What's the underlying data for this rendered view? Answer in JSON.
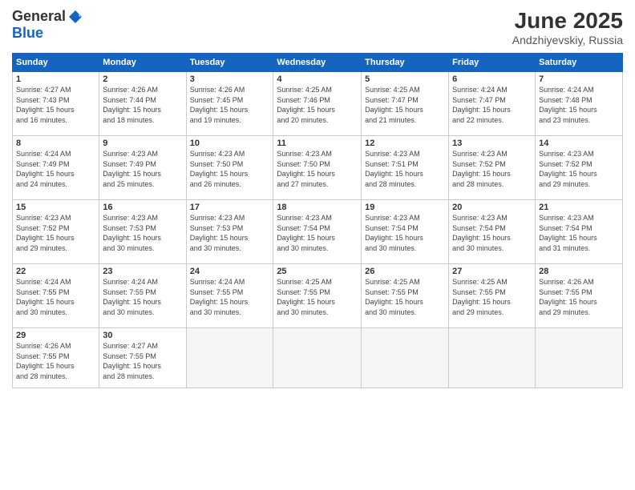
{
  "logo": {
    "general": "General",
    "blue": "Blue"
  },
  "title": "June 2025",
  "location": "Andzhiyevskiy, Russia",
  "days_of_week": [
    "Sunday",
    "Monday",
    "Tuesday",
    "Wednesday",
    "Thursday",
    "Friday",
    "Saturday"
  ],
  "weeks": [
    [
      {
        "day": "1",
        "info": "Sunrise: 4:27 AM\nSunset: 7:43 PM\nDaylight: 15 hours\nand 16 minutes."
      },
      {
        "day": "2",
        "info": "Sunrise: 4:26 AM\nSunset: 7:44 PM\nDaylight: 15 hours\nand 18 minutes."
      },
      {
        "day": "3",
        "info": "Sunrise: 4:26 AM\nSunset: 7:45 PM\nDaylight: 15 hours\nand 19 minutes."
      },
      {
        "day": "4",
        "info": "Sunrise: 4:25 AM\nSunset: 7:46 PM\nDaylight: 15 hours\nand 20 minutes."
      },
      {
        "day": "5",
        "info": "Sunrise: 4:25 AM\nSunset: 7:47 PM\nDaylight: 15 hours\nand 21 minutes."
      },
      {
        "day": "6",
        "info": "Sunrise: 4:24 AM\nSunset: 7:47 PM\nDaylight: 15 hours\nand 22 minutes."
      },
      {
        "day": "7",
        "info": "Sunrise: 4:24 AM\nSunset: 7:48 PM\nDaylight: 15 hours\nand 23 minutes."
      }
    ],
    [
      {
        "day": "8",
        "info": "Sunrise: 4:24 AM\nSunset: 7:49 PM\nDaylight: 15 hours\nand 24 minutes."
      },
      {
        "day": "9",
        "info": "Sunrise: 4:23 AM\nSunset: 7:49 PM\nDaylight: 15 hours\nand 25 minutes."
      },
      {
        "day": "10",
        "info": "Sunrise: 4:23 AM\nSunset: 7:50 PM\nDaylight: 15 hours\nand 26 minutes."
      },
      {
        "day": "11",
        "info": "Sunrise: 4:23 AM\nSunset: 7:50 PM\nDaylight: 15 hours\nand 27 minutes."
      },
      {
        "day": "12",
        "info": "Sunrise: 4:23 AM\nSunset: 7:51 PM\nDaylight: 15 hours\nand 28 minutes."
      },
      {
        "day": "13",
        "info": "Sunrise: 4:23 AM\nSunset: 7:52 PM\nDaylight: 15 hours\nand 28 minutes."
      },
      {
        "day": "14",
        "info": "Sunrise: 4:23 AM\nSunset: 7:52 PM\nDaylight: 15 hours\nand 29 minutes."
      }
    ],
    [
      {
        "day": "15",
        "info": "Sunrise: 4:23 AM\nSunset: 7:52 PM\nDaylight: 15 hours\nand 29 minutes."
      },
      {
        "day": "16",
        "info": "Sunrise: 4:23 AM\nSunset: 7:53 PM\nDaylight: 15 hours\nand 30 minutes."
      },
      {
        "day": "17",
        "info": "Sunrise: 4:23 AM\nSunset: 7:53 PM\nDaylight: 15 hours\nand 30 minutes."
      },
      {
        "day": "18",
        "info": "Sunrise: 4:23 AM\nSunset: 7:54 PM\nDaylight: 15 hours\nand 30 minutes."
      },
      {
        "day": "19",
        "info": "Sunrise: 4:23 AM\nSunset: 7:54 PM\nDaylight: 15 hours\nand 30 minutes."
      },
      {
        "day": "20",
        "info": "Sunrise: 4:23 AM\nSunset: 7:54 PM\nDaylight: 15 hours\nand 30 minutes."
      },
      {
        "day": "21",
        "info": "Sunrise: 4:23 AM\nSunset: 7:54 PM\nDaylight: 15 hours\nand 31 minutes."
      }
    ],
    [
      {
        "day": "22",
        "info": "Sunrise: 4:24 AM\nSunset: 7:55 PM\nDaylight: 15 hours\nand 30 minutes."
      },
      {
        "day": "23",
        "info": "Sunrise: 4:24 AM\nSunset: 7:55 PM\nDaylight: 15 hours\nand 30 minutes."
      },
      {
        "day": "24",
        "info": "Sunrise: 4:24 AM\nSunset: 7:55 PM\nDaylight: 15 hours\nand 30 minutes."
      },
      {
        "day": "25",
        "info": "Sunrise: 4:25 AM\nSunset: 7:55 PM\nDaylight: 15 hours\nand 30 minutes."
      },
      {
        "day": "26",
        "info": "Sunrise: 4:25 AM\nSunset: 7:55 PM\nDaylight: 15 hours\nand 30 minutes."
      },
      {
        "day": "27",
        "info": "Sunrise: 4:25 AM\nSunset: 7:55 PM\nDaylight: 15 hours\nand 29 minutes."
      },
      {
        "day": "28",
        "info": "Sunrise: 4:26 AM\nSunset: 7:55 PM\nDaylight: 15 hours\nand 29 minutes."
      }
    ],
    [
      {
        "day": "29",
        "info": "Sunrise: 4:26 AM\nSunset: 7:55 PM\nDaylight: 15 hours\nand 28 minutes."
      },
      {
        "day": "30",
        "info": "Sunrise: 4:27 AM\nSunset: 7:55 PM\nDaylight: 15 hours\nand 28 minutes."
      },
      {
        "day": "",
        "info": ""
      },
      {
        "day": "",
        "info": ""
      },
      {
        "day": "",
        "info": ""
      },
      {
        "day": "",
        "info": ""
      },
      {
        "day": "",
        "info": ""
      }
    ]
  ]
}
